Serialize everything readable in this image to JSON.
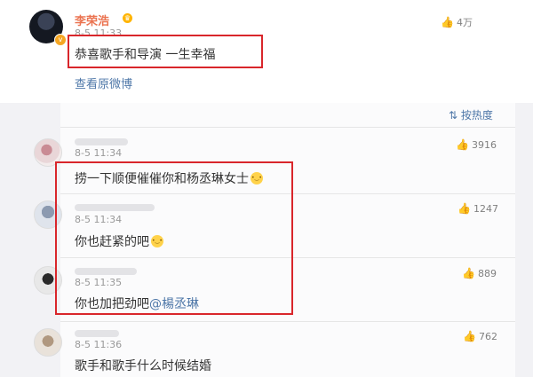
{
  "post": {
    "author": "李荣浩",
    "timestamp": "8-5 11:33",
    "likes": "4万",
    "text": "恭喜歌手和导演 一生幸福",
    "view_original": "查看原微博"
  },
  "sort": {
    "label": "按热度",
    "icon": "sort-icon"
  },
  "comments": [
    {
      "timestamp": "8-5 11:34",
      "likes": "3916",
      "text": "捞一下顺便催催你和杨丞琳女士",
      "emoji": "smile-emoji"
    },
    {
      "timestamp": "8-5 11:34",
      "likes": "1247",
      "text": "你也赶紧的吧",
      "emoji": "cheeky-emoji"
    },
    {
      "timestamp": "8-5 11:35",
      "likes": "889",
      "text_prefix": "你也加把劲吧",
      "mention": "@楊丞琳"
    },
    {
      "timestamp": "8-5 11:36",
      "likes": "762",
      "text": "歌手和歌手什么时候结婚"
    }
  ],
  "colors": {
    "name": "#eb7350",
    "link": "#4e77a8",
    "highlight_box": "#d9262b",
    "feed_bg": "#f2f2f5"
  }
}
